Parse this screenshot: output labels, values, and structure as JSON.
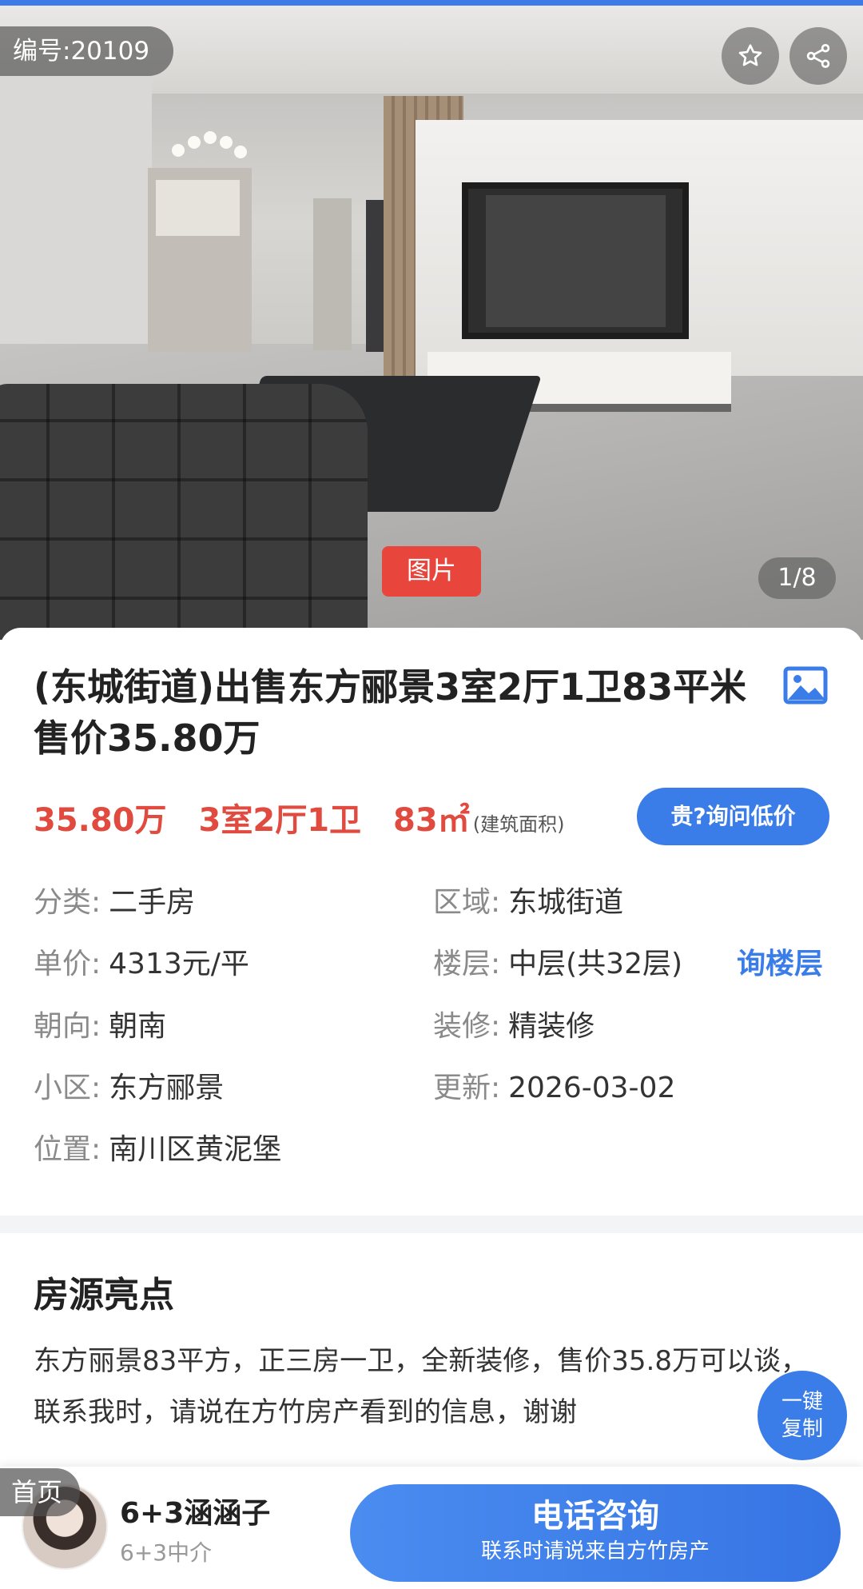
{
  "gallery": {
    "listing_id": "编号:20109",
    "photo_tag": "图片",
    "photo_counter": "1/8",
    "favorite_icon": "star-icon",
    "share_icon": "share-icon"
  },
  "listing": {
    "title": "(东城街道)出售东方郦景3室2厅1卫83平米 售价35.80万",
    "price": "35.80万",
    "layout": "3室2厅1卫",
    "area": "83㎡",
    "area_note": "(建筑面积)",
    "ask_price_button": "贵?询问低价",
    "accent_color": "#e04a3f",
    "brand_color": "#3a7ce8"
  },
  "attributes": {
    "category_label": "分类:",
    "category_value": "二手房",
    "region_label": "区域:",
    "region_value": "东城街道",
    "unit_price_label": "单价:",
    "unit_price_value": "4313元/平",
    "floor_label": "楼层:",
    "floor_value": "中层(共32层)",
    "floor_link": "询楼层",
    "orientation_label": "朝向:",
    "orientation_value": "朝南",
    "decoration_label": "装修:",
    "decoration_value": "精装修",
    "community_label": "小区:",
    "community_value": "东方郦景",
    "updated_label": "更新:",
    "updated_value": "2026-03-02",
    "location_label": "位置:",
    "location_value": "南川区黄泥堡"
  },
  "highlights": {
    "title": "房源亮点",
    "text": "东方丽景83平方，正三房一卫，全新装修，售价35.8万可以谈，联系我时，请说在方竹房产看到的信息，谢谢",
    "copy_line1": "一键",
    "copy_line2": "复制"
  },
  "bottom_bar": {
    "home_tag": "首页",
    "agent_name": "6+3涵涵子",
    "agent_title": "6+3中介",
    "call_main": "电话咨询",
    "call_sub": "联系时请说来自方竹房产"
  }
}
